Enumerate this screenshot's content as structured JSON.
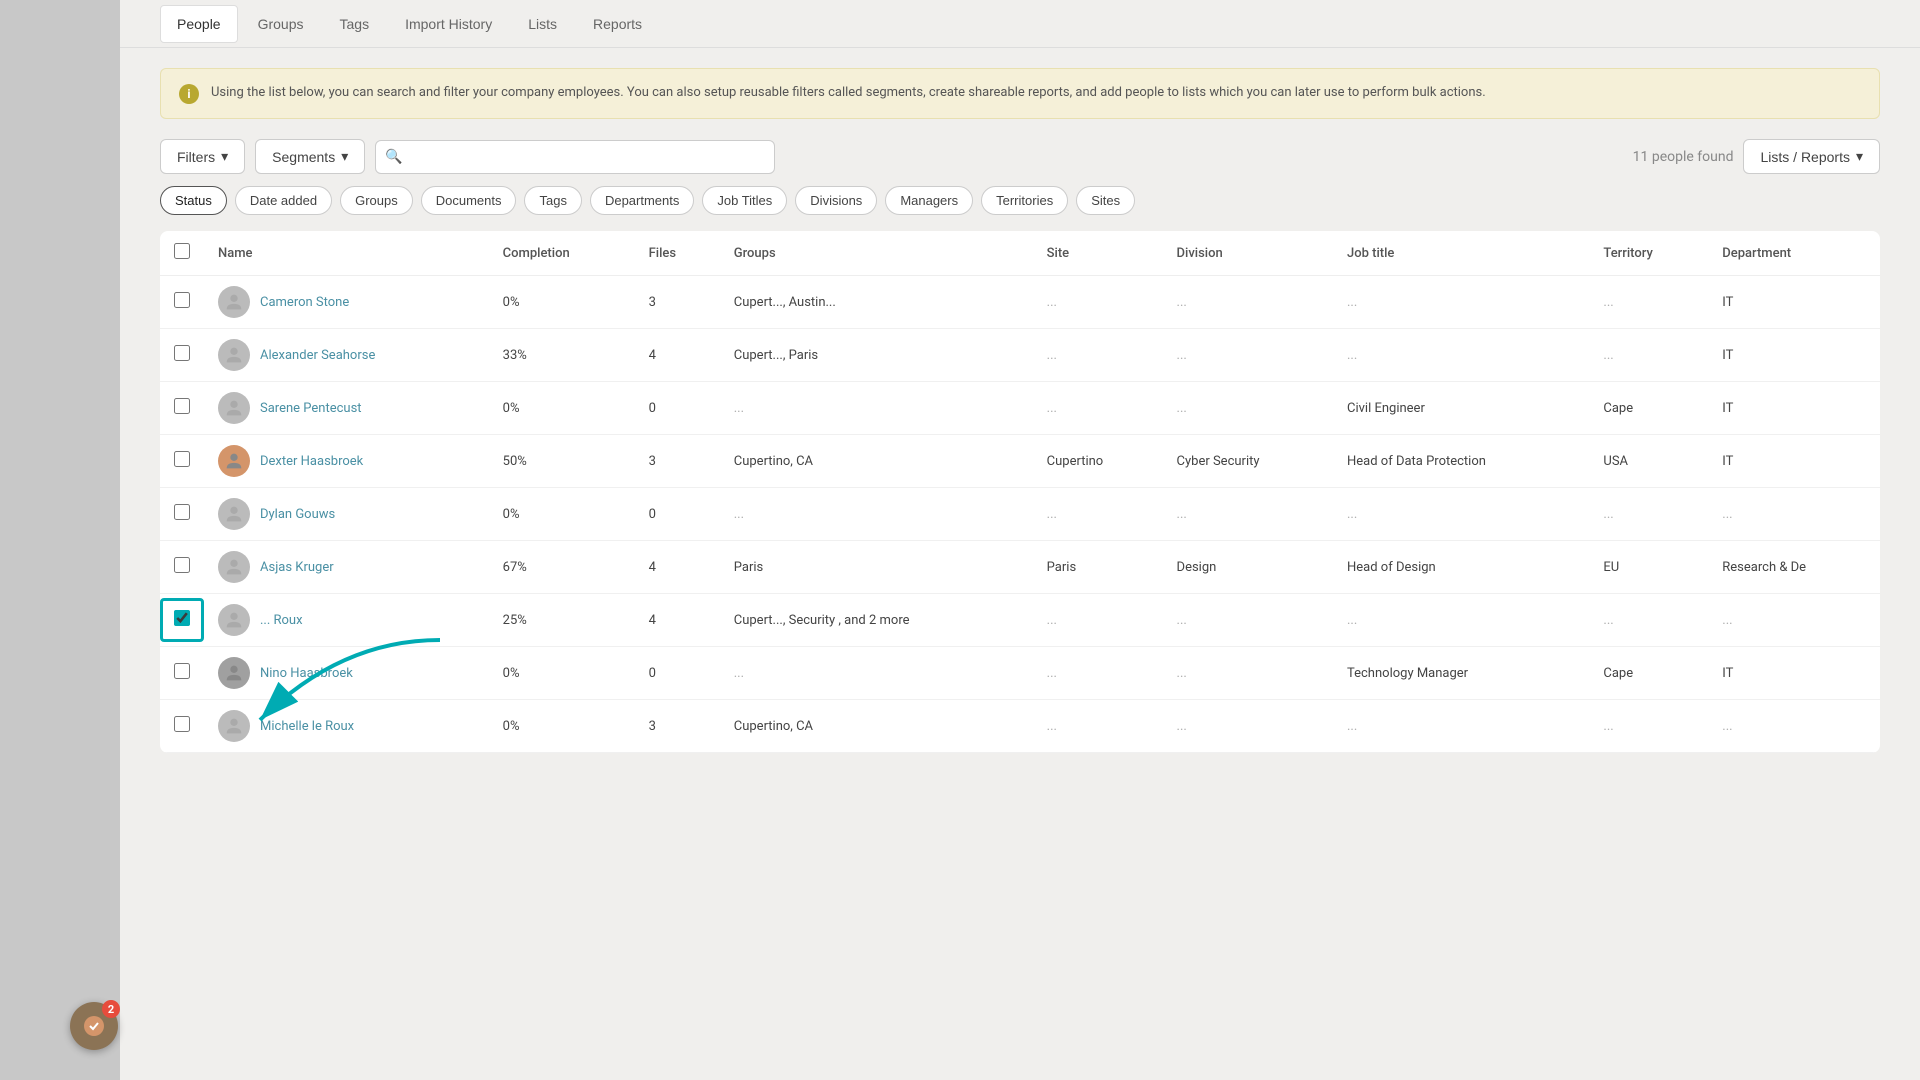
{
  "nav": {
    "tabs": [
      {
        "id": "people",
        "label": "People",
        "active": true
      },
      {
        "id": "groups",
        "label": "Groups",
        "active": false
      },
      {
        "id": "tags",
        "label": "Tags",
        "active": false
      },
      {
        "id": "import-history",
        "label": "Import History",
        "active": false
      },
      {
        "id": "lists",
        "label": "Lists",
        "active": false
      },
      {
        "id": "reports",
        "label": "Reports",
        "active": false
      }
    ]
  },
  "info_banner": {
    "text": "Using the list below, you can search and filter your company employees. You can also setup reusable filters called segments, create shareable reports, and add people to lists which you can later use to perform bulk actions."
  },
  "toolbar": {
    "filters_label": "Filters",
    "segments_label": "Segments",
    "search_placeholder": "",
    "people_count": "11 people found",
    "lists_reports_label": "Lists / Reports"
  },
  "filter_tags": [
    {
      "id": "status",
      "label": "Status",
      "active": true
    },
    {
      "id": "date-added",
      "label": "Date added",
      "active": false
    },
    {
      "id": "groups",
      "label": "Groups",
      "active": false
    },
    {
      "id": "documents",
      "label": "Documents",
      "active": false
    },
    {
      "id": "tags",
      "label": "Tags",
      "active": false
    },
    {
      "id": "departments",
      "label": "Departments",
      "active": false
    },
    {
      "id": "job-titles",
      "label": "Job Titles",
      "active": false
    },
    {
      "id": "divisions",
      "label": "Divisions",
      "active": false
    },
    {
      "id": "managers",
      "label": "Managers",
      "active": false
    },
    {
      "id": "territories",
      "label": "Territories",
      "active": false
    },
    {
      "id": "sites",
      "label": "Sites",
      "active": false
    }
  ],
  "table": {
    "columns": [
      "Name",
      "Completion",
      "Files",
      "Groups",
      "Site",
      "Division",
      "Job title",
      "Territory",
      "Department"
    ],
    "rows": [
      {
        "id": 1,
        "name": "Cameron Stone",
        "completion": "0%",
        "files": "3",
        "groups": "Cupert..., Austin...",
        "site": "...",
        "division": "...",
        "job_title": "...",
        "territory": "...",
        "department": "IT",
        "avatar_type": "default",
        "checked": false
      },
      {
        "id": 2,
        "name": "Alexander Seahorse",
        "completion": "33%",
        "files": "4",
        "groups": "Cupert..., Paris",
        "site": "...",
        "division": "...",
        "job_title": "...",
        "territory": "...",
        "department": "IT",
        "avatar_type": "default",
        "checked": false
      },
      {
        "id": 3,
        "name": "Sarene Pentecust",
        "completion": "0%",
        "files": "0",
        "groups": "...",
        "site": "...",
        "division": "...",
        "job_title": "Civil Engineer",
        "territory": "Cape",
        "department": "IT",
        "avatar_type": "default",
        "checked": false
      },
      {
        "id": 4,
        "name": "Dexter Haasbroek",
        "completion": "50%",
        "files": "3",
        "groups": "Cupertino, CA",
        "site": "Cupertino",
        "division": "Cyber Security",
        "job_title": "Head of Data Protection",
        "territory": "USA",
        "department": "IT",
        "avatar_type": "photo",
        "checked": false
      },
      {
        "id": 5,
        "name": "Dylan Gouws",
        "completion": "0%",
        "files": "0",
        "groups": "...",
        "site": "...",
        "division": "...",
        "job_title": "...",
        "territory": "...",
        "department": "...",
        "avatar_type": "default",
        "checked": false
      },
      {
        "id": 6,
        "name": "Asjas Kruger",
        "completion": "67%",
        "files": "4",
        "groups": "Paris",
        "site": "Paris",
        "division": "Design",
        "job_title": "Head of Design",
        "territory": "EU",
        "department": "Research & De",
        "avatar_type": "default",
        "checked": false
      },
      {
        "id": 7,
        "name": "... Roux",
        "completion": "25%",
        "files": "4",
        "groups": "Cupert..., Security , and 2 more",
        "site": "...",
        "division": "...",
        "job_title": "...",
        "territory": "...",
        "department": "...",
        "avatar_type": "default",
        "checked": true,
        "highlighted": true
      },
      {
        "id": 8,
        "name": "Nino Haasbroek",
        "completion": "0%",
        "files": "0",
        "groups": "...",
        "site": "...",
        "division": "...",
        "job_title": "Technology Manager",
        "territory": "Cape",
        "department": "IT",
        "avatar_type": "nino",
        "checked": false
      },
      {
        "id": 9,
        "name": "Michelle le Roux",
        "completion": "0%",
        "files": "3",
        "groups": "Cupertino, CA",
        "site": "...",
        "division": "...",
        "job_title": "...",
        "territory": "...",
        "department": "...",
        "avatar_type": "default",
        "checked": false
      }
    ]
  },
  "notification": {
    "count": "2"
  }
}
